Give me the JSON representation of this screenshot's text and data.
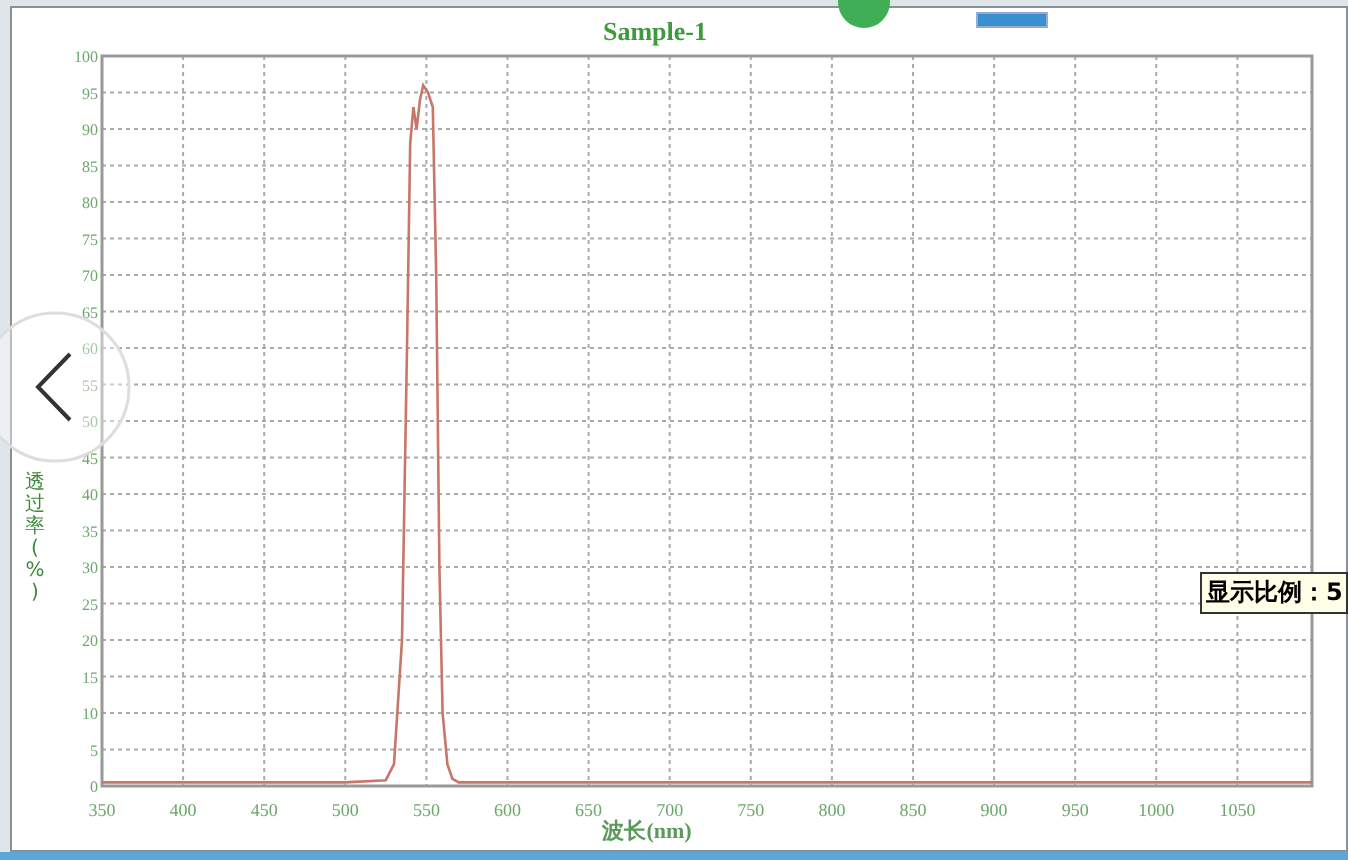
{
  "chart": {
    "chart_data": {
      "type": "line",
      "title": "Sample-1",
      "xlabel": "波长(nm)",
      "ylabel": "透过率(%)",
      "xlim": [
        350,
        1096
      ],
      "ylim": [
        0,
        100
      ],
      "xticks": [
        350,
        400,
        450,
        500,
        550,
        600,
        650,
        700,
        750,
        800,
        850,
        900,
        950,
        1000,
        1050
      ],
      "yticks": [
        0,
        5,
        10,
        15,
        20,
        25,
        30,
        35,
        40,
        45,
        50,
        55,
        60,
        65,
        70,
        75,
        80,
        85,
        90,
        95,
        100
      ],
      "x": [
        350,
        400,
        500,
        525,
        530,
        535,
        538,
        540,
        542,
        544,
        546,
        548,
        551,
        554,
        556,
        558,
        560,
        563,
        566,
        570,
        600,
        700,
        800,
        900,
        1000,
        1096
      ],
      "grid": true,
      "series": [
        {
          "color": "#c8766a",
          "values": [
            0.5,
            0.5,
            0.5,
            0.8,
            3,
            20,
            60,
            88,
            93,
            90,
            94,
            96,
            95,
            93,
            70,
            30,
            10,
            3,
            1,
            0.5,
            0.5,
            0.5,
            0.5,
            0.5,
            0.5,
            0.5
          ]
        }
      ]
    }
  },
  "tooltip": {
    "text": "显示比例：5"
  }
}
